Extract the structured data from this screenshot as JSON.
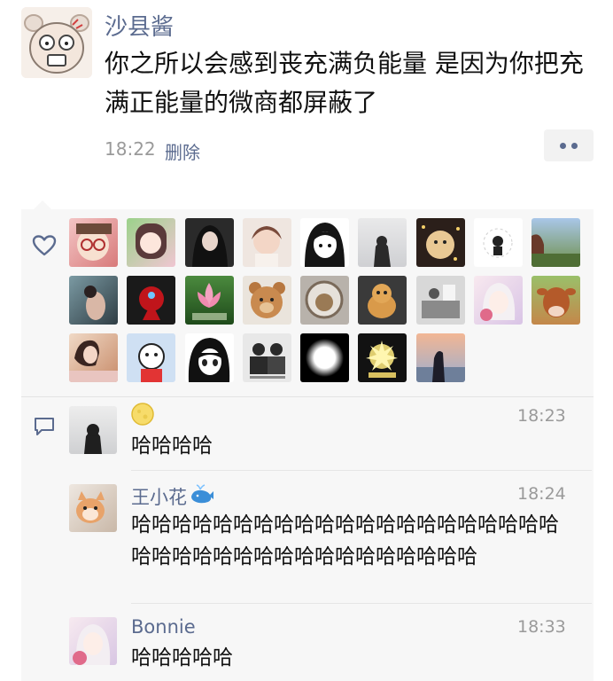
{
  "post": {
    "author": "沙县酱",
    "text": "你之所以会感到丧充满负能量 是因为你把充满正能量的微商都屏蔽了",
    "time": "18:22",
    "delete_label": "删除",
    "more_icon": "more-dots-icon"
  },
  "likes": {
    "icon": "heart-icon",
    "count_shown": 25
  },
  "comments": [
    {
      "name": "",
      "name_emoji": "moon-emoji",
      "time": "18:23",
      "text": "哈哈哈哈"
    },
    {
      "name": "王小花",
      "name_emoji": "whale-emoji",
      "time": "18:24",
      "text": "哈哈哈哈哈哈哈哈哈哈哈哈哈哈哈哈哈哈哈哈哈哈哈哈哈哈哈哈哈哈哈哈哈哈哈哈哈哈"
    },
    {
      "name": "Bonnie",
      "name_emoji": "",
      "time": "18:33",
      "text": "哈哈哈哈哈"
    }
  ],
  "colors": {
    "link_blue": "#5b6b8f",
    "panel_bg": "#f7f7f7",
    "meta_gray": "#9a9a9a"
  }
}
